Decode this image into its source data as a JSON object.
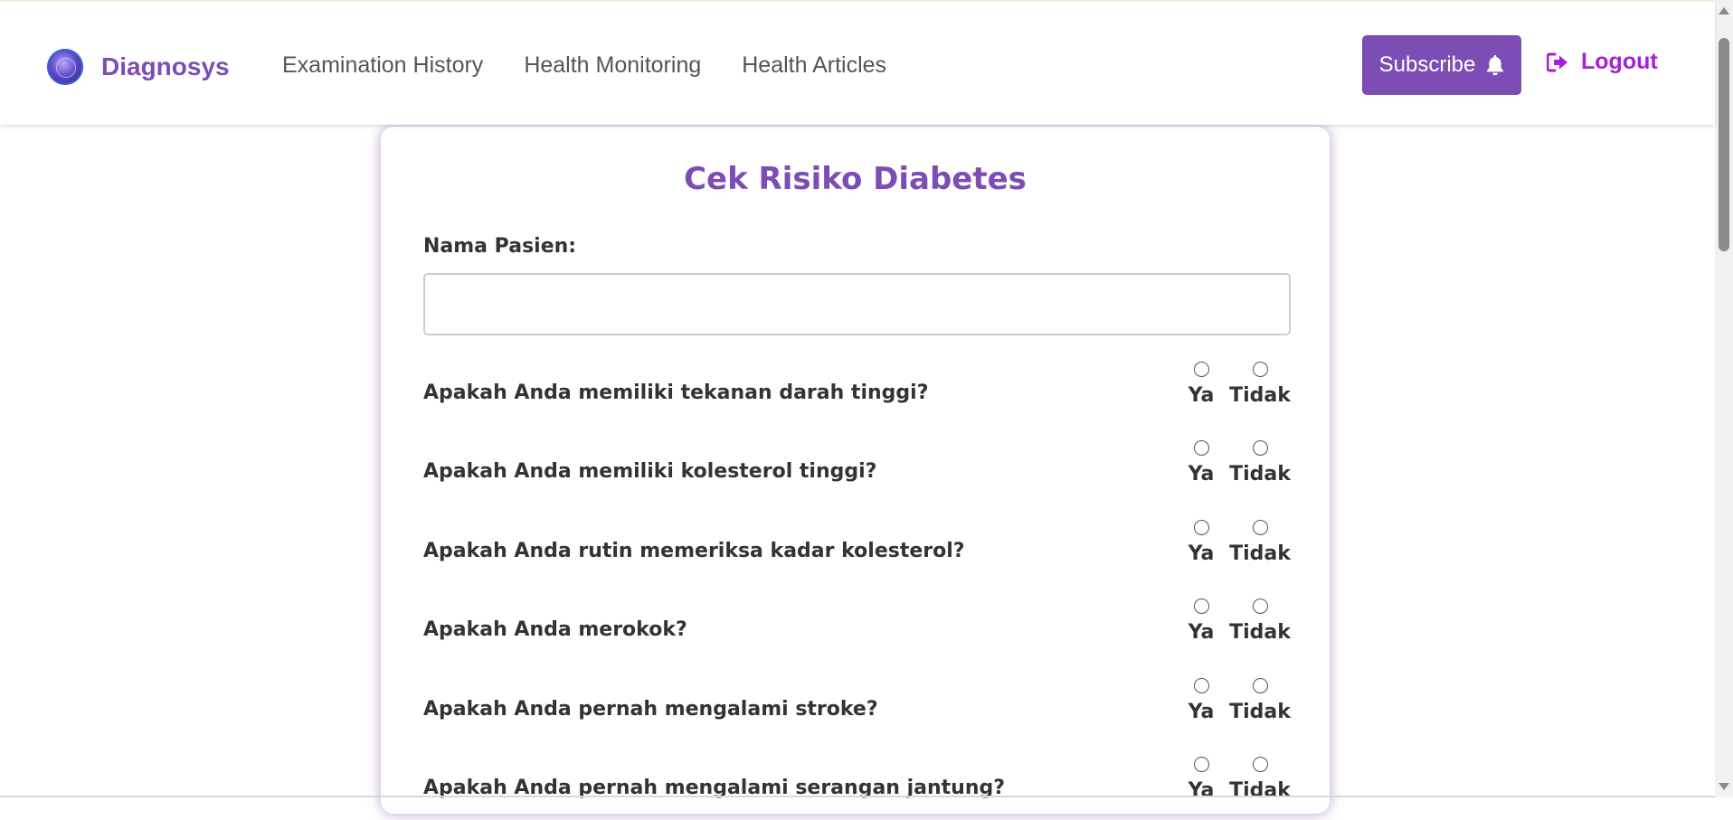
{
  "brand": {
    "name": "Diagnosys",
    "logo_icon": "brand-globe-icon"
  },
  "nav": {
    "links": [
      "Examination History",
      "Health Monitoring",
      "Health Articles"
    ],
    "subscribe_label": "Subscribe",
    "subscribe_icon": "bell-icon",
    "logout_label": "Logout",
    "logout_icon": "sign-out-icon"
  },
  "form": {
    "title": "Cek Risiko Diabetes",
    "name_label": "Nama Pasien:",
    "name_value": "",
    "option_yes": "Ya",
    "option_no": "Tidak",
    "questions": [
      "Apakah Anda memiliki tekanan darah tinggi?",
      "Apakah Anda memiliki kolesterol tinggi?",
      "Apakah Anda rutin memeriksa kadar kolesterol?",
      "Apakah Anda merokok?",
      "Apakah Anda pernah mengalami stroke?",
      "Apakah Anda pernah mengalami serangan jantung?"
    ]
  },
  "colors": {
    "accent": "#7c4db4",
    "logout": "#a61fd6",
    "text": "#333333"
  }
}
